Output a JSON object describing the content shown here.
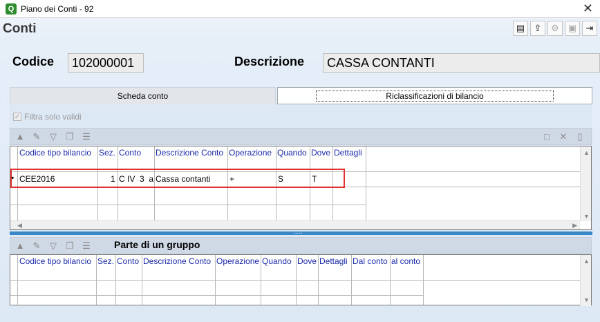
{
  "window": {
    "title": "Piano dei Conti - 92"
  },
  "form": {
    "title": "Conti"
  },
  "toolbar": {
    "icons": [
      "report-icon",
      "export-icon",
      "settings-icon",
      "save-icon",
      "exit-icon"
    ]
  },
  "fields": {
    "codice_label": "Codice",
    "codice_value": "102000001",
    "descrizione_label": "Descrizione",
    "descrizione_value": "CASSA CONTANTI"
  },
  "tabs": [
    {
      "label": "Scheda conto",
      "active": false
    },
    {
      "label": "Riclassificazioni di bilancio",
      "active": true
    }
  ],
  "filter": {
    "label": "Filtra solo validi",
    "checked": true
  },
  "grid1": {
    "columns": [
      "Codice tipo bilancio",
      "Sez.",
      "Conto",
      "Descrizione Conto",
      "Operazione",
      "Quando",
      "Dove",
      "Dettagli"
    ],
    "rows": [
      {
        "codice": "CEE2016",
        "sez": "1",
        "conto": "C IV  3  a",
        "descrizione": "Cassa contanti",
        "operazione": "+",
        "quando": "S",
        "dove": "T",
        "dettagli": ""
      }
    ]
  },
  "group": {
    "title": "Parte di un gruppo",
    "columns": [
      "Codice tipo bilancio",
      "Sez.",
      "Conto",
      "Descrizione Conto",
      "Operazione",
      "Quando",
      "Dove",
      "Dettagli",
      "Dal conto",
      "al conto"
    ]
  },
  "splitter": {
    "grip": "....."
  },
  "glyphs": {
    "close": "✕",
    "checkmark": "✓",
    "row_pointer": "▸",
    "app_icon": "Q"
  },
  "colors": {
    "header_text": "#1a2aa8",
    "highlight": "#e03030",
    "splitter": "#3a87c8"
  }
}
